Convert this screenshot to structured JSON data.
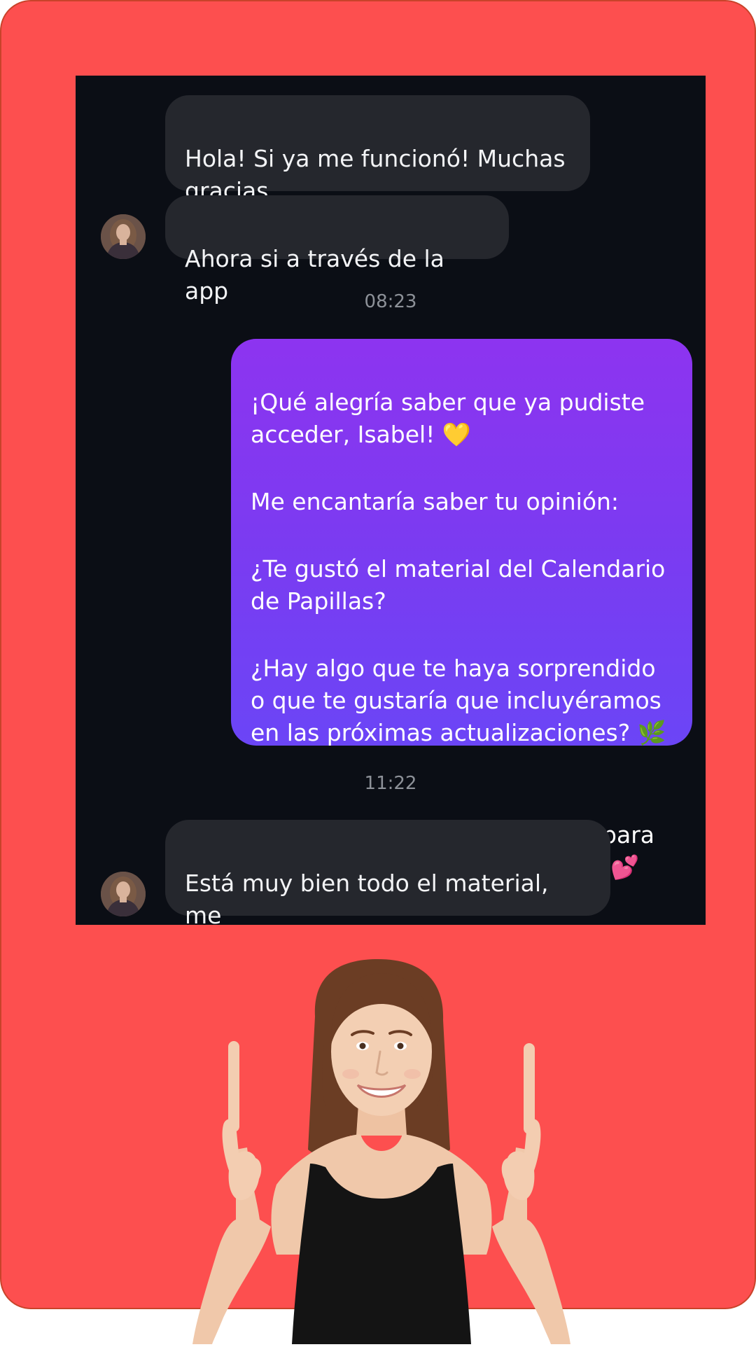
{
  "conversation": {
    "messages": [
      {
        "id": "m1",
        "direction": "incoming",
        "text": "Hola! Si ya me funcionó! Muchas\ngracias"
      },
      {
        "id": "m2",
        "direction": "incoming",
        "text": "Ahora si a través de la app"
      },
      {
        "id": "t1",
        "type": "timestamp",
        "text": "08:23"
      },
      {
        "id": "m3",
        "direction": "outgoing",
        "paragraphs": [
          "¡Qué alegría saber que ya pudiste\nacceder, Isabel! 💛",
          "Me encantaría saber tu opinión:",
          "¿Te gustó el material del Calendario\nde Papillas?",
          "¿Hay algo que te haya sorprendido\no que te gustaría que incluyéramos\nen las próximas actualizaciones? 🌿",
          "Tu comentario es muy valioso para\nseguir mejorando cada detalle 💕"
        ]
      },
      {
        "id": "t2",
        "type": "timestamp",
        "text": "11:22"
      },
      {
        "id": "m4",
        "direction": "incoming",
        "text": "Está muy bien todo el material, me\ngustó mucho ☺️"
      }
    ]
  },
  "avatar": {
    "icon": "user-avatar-icon",
    "colors": {
      "hair": "#7a5a45",
      "skin": "#d9b39c",
      "clothing": "#3a2f3a"
    }
  },
  "colors": {
    "background": "#fd4f4f",
    "chat_background": "#0b0e15",
    "incoming_bubble": "#25272d",
    "outgoing_gradient_top": "#8d34f0",
    "outgoing_gradient_bottom": "#6b45f6",
    "timestamp": "#8d9198"
  },
  "promo_image": {
    "icon": "woman-pointing-up-illustration"
  }
}
